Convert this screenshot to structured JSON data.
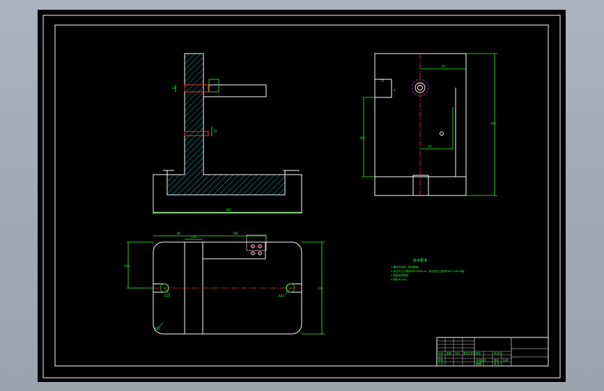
{
  "colors": {
    "background_outer": "#a0a8b3",
    "canvas": "#000000",
    "outline": "#ffffff",
    "dimension": "#33ff33",
    "hatch": "#00c8c8",
    "centerline": "#ff3333",
    "circle_mark": "#cc33cc"
  },
  "views": {
    "front": {
      "dim_width": "360",
      "dim_small_1": "10",
      "dim_small_2": "10"
    },
    "side": {
      "dim_top": "50",
      "dim_top_right": "72",
      "dim_height_right": "300",
      "dim_height_left": "160",
      "dim_inner": "16",
      "dim_small": "4"
    },
    "plan": {
      "dim_top_1": "80",
      "dim_top_2": "120",
      "dim_top_3": "180",
      "dim_left": "100",
      "dim_right": "250",
      "dim_r_left": "R20",
      "dim_r_right": "R20",
      "dim_r_corner": "R30"
    }
  },
  "notes": {
    "title": "技术要求",
    "lines": [
      "1.铸件去毛刺，锐边倒钝。",
      "2.未注尺寸公差按GB/T1804-m，未注形位公差按GB/T1184-K级。",
      "3.表面涂防锈漆。",
      "4.材料HT200。"
    ]
  },
  "title_block": {
    "cells": [
      "标记",
      "处数",
      "分区",
      "更改文件号",
      "签名",
      "年月日",
      "设计",
      "审核",
      "工艺",
      "批准",
      "阶段标记",
      "重量",
      "比例",
      "共 张",
      "第 张"
    ]
  }
}
